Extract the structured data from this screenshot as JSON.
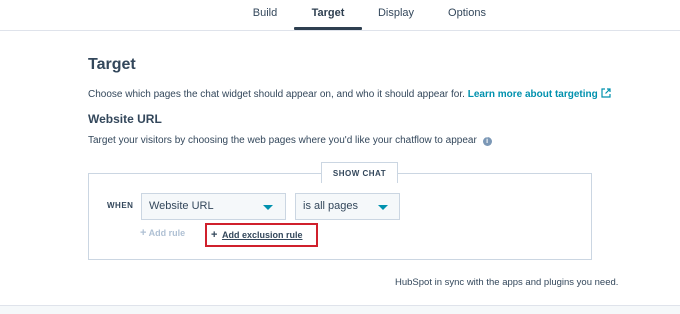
{
  "tabs": [
    {
      "label": "Build"
    },
    {
      "label": "Target"
    },
    {
      "label": "Display"
    },
    {
      "label": "Options"
    }
  ],
  "active_tab": "Target",
  "section": {
    "title": "Target",
    "description": "Choose which pages the chat widget should appear on, and who it should appear for.",
    "learn_more": "Learn more about targeting"
  },
  "website_url": {
    "title": "Website URL",
    "description": "Target your visitors by choosing the web pages where you'd like your chatflow to appear"
  },
  "rule": {
    "show_chat_label": "SHOW CHAT",
    "when_label": "WHEN",
    "field_select": "Website URL",
    "condition_select": "is all pages",
    "add_rule": "Add rule",
    "add_exclusion_rule": "Add exclusion rule"
  },
  "footer": {
    "text": "HubSpot in sync with the apps and plugins you need."
  },
  "colors": {
    "accent_link": "#0091ae",
    "highlight_border": "#d0202c",
    "text": "#33475b"
  }
}
